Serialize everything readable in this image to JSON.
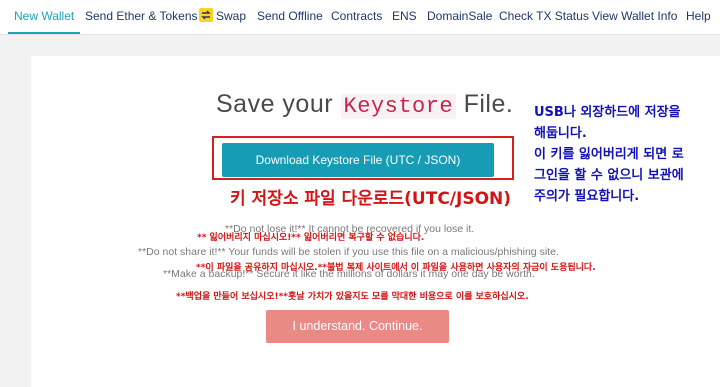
{
  "nav": {
    "items": [
      {
        "label": "New Wallet",
        "active": true
      },
      {
        "label": "Send Ether & Tokens"
      },
      {
        "label": "Swap",
        "icon": "swap-icon"
      },
      {
        "label": "Send Offline"
      },
      {
        "label": "Contracts"
      },
      {
        "label": "ENS"
      },
      {
        "label": "DomainSale"
      },
      {
        "label": "Check TX Status"
      },
      {
        "label": "View Wallet Info"
      },
      {
        "label": "Help"
      }
    ],
    "active_color": "#1ba6b8",
    "text_color": "#21386b"
  },
  "main": {
    "title_prefix": "Save your",
    "title_code": "Keystore",
    "title_suffix": "File.",
    "download_button": "Download Keystore File (UTC / JSON)",
    "warnings": {
      "lose_it": "**Do not lose it!** It cannot be recovered if you lose it.",
      "share_it": "**Do not share it!** Your funds will be stolen if you use this file on a malicious/phishing site.",
      "backup": "**Make a backup!** Secure it like the millions of dollars it may one day be worth."
    },
    "continue_button": "I understand. Continue.",
    "button_color": "#169cb4",
    "continue_color": "#e98a84"
  },
  "annotations": {
    "download_note": "키 저장소 파일 다운로드(UTC/JSON)",
    "side_note": [
      "USB나 외장하드에 저장을",
      "해둡니다.",
      "이 키를 잃어버리게 되면 로",
      "그인을 할 수 없으니 보관에",
      "주의가 필요합니다."
    ],
    "lose_kr": "** 잃어버리지 마십시오!** 잃어버리면 복구할 수 없습니다.",
    "share_kr": "**이 파일을 공유하지 마십시오.**불법 복제 사이트에서 이 파일을 사용하면 사용자의 자금이 도용됩니다.",
    "backup_kr": "**백업을 만들어 보십시오!**훗날 가치가 있을지도 모를 막대한 비용으로 이를 보호하십시오.",
    "red": "#d41414",
    "blue": "#1212b8"
  }
}
